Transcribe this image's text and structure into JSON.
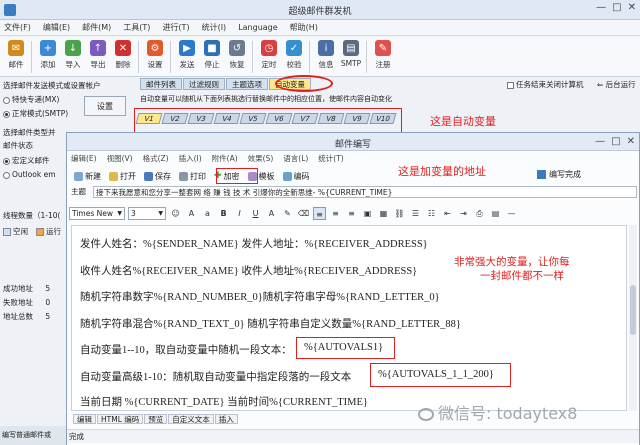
{
  "window": {
    "title": "超级邮件群发机",
    "controls": [
      "—",
      "□",
      "✕"
    ]
  },
  "menu": [
    "文件(F)",
    "编辑(E)",
    "邮件(M)",
    "工具(T)",
    "进行(T)",
    "统计(I)",
    "Language",
    "帮助(H)"
  ],
  "toolbar": [
    {
      "label": "邮件",
      "icon": "mail-icon",
      "color": "#d28a1c"
    },
    {
      "label": "添加",
      "icon": "add-icon",
      "color": "#3a8ad6"
    },
    {
      "label": "导入",
      "icon": "import-icon",
      "color": "#4aa24a"
    },
    {
      "label": "导出",
      "icon": "export-icon",
      "color": "#7a5cc0"
    },
    {
      "label": "删除",
      "icon": "delete-icon",
      "color": "#d03030"
    },
    {
      "label": "设置",
      "icon": "settings-icon",
      "color": "#e05a2a"
    },
    {
      "label": "发送",
      "icon": "send-icon",
      "color": "#2c78d0"
    },
    {
      "label": "停止",
      "icon": "stop-icon",
      "color": "#2c6fb6"
    },
    {
      "label": "恢复",
      "icon": "restore-icon",
      "color": "#6a7a90"
    },
    {
      "label": "定时",
      "icon": "clock-icon",
      "color": "#d84040"
    },
    {
      "label": "校验",
      "icon": "verify-icon",
      "color": "#3590d0"
    },
    {
      "label": "信息",
      "icon": "info-icon",
      "color": "#4a6fa8"
    },
    {
      "label": "SMTP",
      "icon": "smtp-icon",
      "color": "#5a6a80"
    },
    {
      "label": "注册",
      "icon": "register-icon",
      "color": "#e05050"
    }
  ],
  "left": {
    "mode_title": "选择邮件发送模式或设置帐户",
    "modes": [
      "特快专递(MX)",
      "正常模式(SMTP)"
    ],
    "set_button": "设置",
    "type_title": "选择邮件类型并",
    "status_label": "邮件状态",
    "client_modes": [
      "宏定义邮件",
      "Outlook em"
    ],
    "threads": "线程数量（1-10(",
    "legend": [
      "空闲",
      "运行"
    ],
    "stats": [
      {
        "label": "成功地址",
        "value": "5"
      },
      {
        "label": "失败地址",
        "value": "0"
      },
      {
        "label": "地址总数",
        "value": "5"
      }
    ],
    "bottom": "编写普通邮件或"
  },
  "main_tabs": [
    "邮件列表",
    "过滤规则",
    "主题选项",
    "自动变量"
  ],
  "close_after": "任务结束关闭计算机",
  "background_run": "后台运行",
  "hint": "自动变量可以随机从下面列表挑选行替换邮件中的相应位置，使邮件内容自动变化",
  "vtabs": [
    "V1",
    "V2",
    "V3",
    "V4",
    "V5",
    "V6",
    "V7",
    "V8",
    "V9",
    "V10"
  ],
  "annotations": {
    "auto_var": "这是自动变量",
    "var_addr": "这是加变量的地址",
    "powerful": "非常强大的变量，让你每",
    "powerful2": "一封邮件都不一样"
  },
  "dialog": {
    "title": "邮件编写",
    "menu": [
      "编辑(E)",
      "视图(V)",
      "格式(Z)",
      "插入(I)",
      "附件(A)",
      "效果(S)",
      "语言(L)",
      "统计(T)"
    ],
    "tools": [
      "新建",
      "打开",
      "保存",
      "打印",
      "加密",
      "模板",
      "编码"
    ],
    "finish": "编写完成",
    "subject_label": "主题",
    "subject": "接下来我愿意和您分享一整套网 络 赚 钱 技 术 引爆你的全新思维- %{CURRENT_TIME}",
    "font": "Times New",
    "size": "3",
    "lines": [
      "发件人姓名：%{SENDER_NAME} 发件人地址：%{RECEIVER_ADDRESS}",
      "收件人姓名%{RECEIVER_NAME} 收件人地址%{RECEIVER_ADDRESS}",
      "随机字符串数字%{RAND_NUMBER_0}随机字符串字母%{RAND_LETTER_0}",
      "随机字符串混合%{RAND_TEXT_0} 随机字符串自定义数量%{RAND_LETTER_88}",
      "自动变量1--10，取自动变量中随机一段文本：",
      "%{AUTOVALS1}",
      "自动变量高级1-10：随机取自动变量中指定段落的一段文本",
      "%{AUTOVALS_1_1_200}",
      "当前日期 %{CURRENT_DATE}  当前时间%{CURRENT_TIME}"
    ],
    "bottom_tabs": [
      "编辑",
      "HTML 编码",
      "预览",
      "自定义文本",
      "插入"
    ],
    "status": "完成"
  },
  "watermark": "微信号: todaytex8"
}
